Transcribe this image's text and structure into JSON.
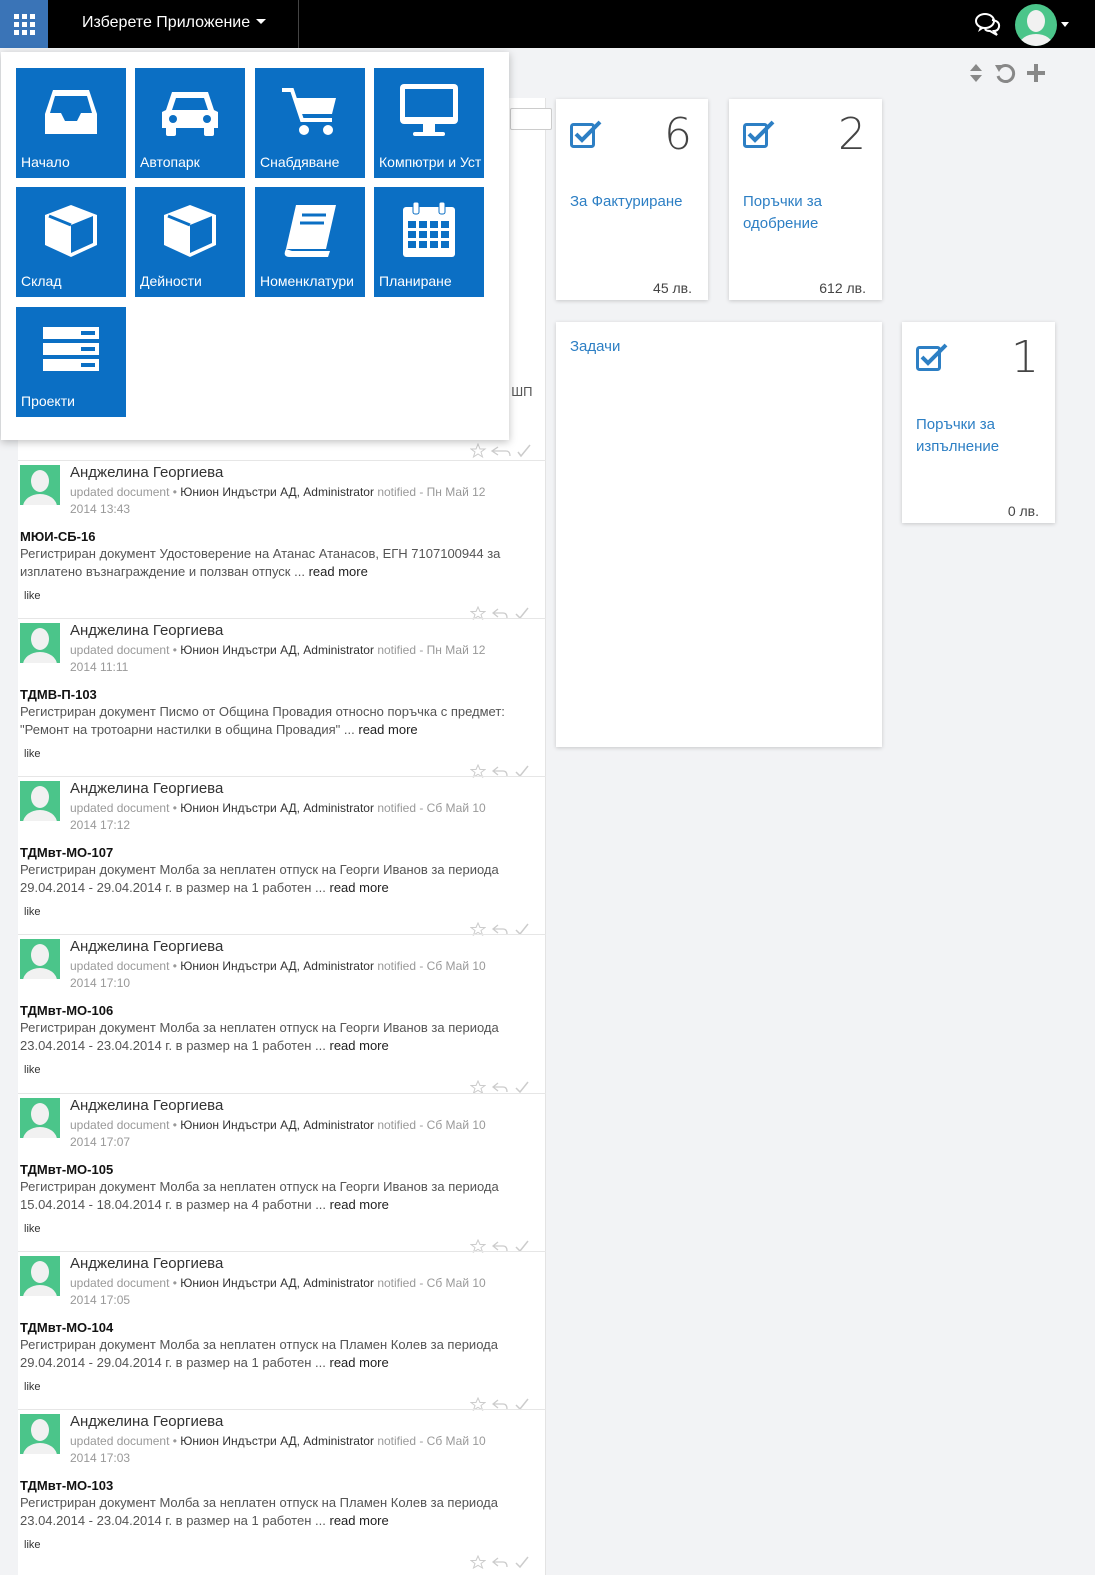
{
  "header": {
    "app_select_label": "Изберете Приложение"
  },
  "launcher": {
    "tiles": [
      {
        "label": "Начало",
        "icon": "inbox-icon"
      },
      {
        "label": "Автопарк",
        "icon": "car-icon"
      },
      {
        "label": "Снабдяване",
        "icon": "cart-icon"
      },
      {
        "label": "Компютри и Уст",
        "icon": "monitor-icon"
      },
      {
        "label": "Склад",
        "icon": "box-icon"
      },
      {
        "label": "Дейности",
        "icon": "box-icon"
      },
      {
        "label": "Номенклатури",
        "icon": "book-icon"
      },
      {
        "label": "Планиране",
        "icon": "calendar-icon"
      },
      {
        "label": "Проекти",
        "icon": "server-icon"
      }
    ]
  },
  "feed": {
    "partial_text": "ı ШП",
    "posts": [
      {
        "author": "Анджелина Георгиева",
        "action": "updated document",
        "org": "Юнион Индъстри АД, Administrator",
        "notified": "notified - Пн Май 12",
        "time": "2014 13:43",
        "code": "МЮИ-СБ-16",
        "body": "Регистриран документ Удостоверение на Атанас Атанасов, ЕГН 7107100944 за изплатено възнаграждение и ползван отпуск ...",
        "read_more": "read more",
        "like": "like"
      },
      {
        "author": "Анджелина Георгиева",
        "action": "updated document",
        "org": "Юнион Индъстри АД, Administrator",
        "notified": "notified - Пн Май 12",
        "time": "2014 11:11",
        "code": "ТДМВ-П-103",
        "body": "Регистриран документ Писмо от Община Провадия относно поръчка с предмет: \"Ремонт на тротоарни настилки в община Провадия\" ...",
        "read_more": "read more",
        "like": "like"
      },
      {
        "author": "Анджелина Георгиева",
        "action": "updated document",
        "org": "Юнион Индъстри АД, Administrator",
        "notified": "notified - Сб Май 10",
        "time": "2014 17:12",
        "code": "ТДМвт-МО-107",
        "body": "Регистриран документ Молба за неплатен отпуск на Георги Иванов за периода 29.04.2014 - 29.04.2014 г. в размер на 1 работен ...",
        "read_more": "read more",
        "like": "like"
      },
      {
        "author": "Анджелина Георгиева",
        "action": "updated document",
        "org": "Юнион Индъстри АД, Administrator",
        "notified": "notified - Сб Май 10",
        "time": "2014 17:10",
        "code": "ТДМвт-МО-106",
        "body": "Регистриран документ Молба за неплатен отпуск на Георги Иванов за периода 23.04.2014 - 23.04.2014 г. в размер на 1 работен ...",
        "read_more": "read more",
        "like": "like"
      },
      {
        "author": "Анджелина Георгиева",
        "action": "updated document",
        "org": "Юнион Индъстри АД, Administrator",
        "notified": "notified - Сб Май 10",
        "time": "2014 17:07",
        "code": "ТДМвт-МО-105",
        "body": "Регистриран документ Молба за неплатен отпуск на Георги Иванов за периода 15.04.2014 - 18.04.2014 г. в размер на 4 работни ...",
        "read_more": "read more",
        "like": "like"
      },
      {
        "author": "Анджелина Георгиева",
        "action": "updated document",
        "org": "Юнион Индъстри АД, Administrator",
        "notified": "notified - Сб Май 10",
        "time": "2014 17:05",
        "code": "ТДМвт-МО-104",
        "body": "Регистриран документ Молба за неплатен отпуск на Пламен Колев за периода 29.04.2014 - 29.04.2014 г. в размер на 1 работен ...",
        "read_more": "read more",
        "like": "like"
      },
      {
        "author": "Анджелина Георгиева",
        "action": "updated document",
        "org": "Юнион Индъстри АД, Administrator",
        "notified": "notified - Сб Май 10",
        "time": "2014 17:03",
        "code": "ТДМвт-МО-103",
        "body": "Регистриран документ Молба за неплатен отпуск на Пламен Колев за периода 23.04.2014 - 23.04.2014 г. в размер на 1 работен ...",
        "read_more": "read more",
        "like": "like"
      }
    ]
  },
  "cards": {
    "invoicing": {
      "count": "6",
      "title": "За Фактуриране",
      "amount": "45 лв."
    },
    "orders_approval": {
      "count": "2",
      "title": "Поръчки за одобрение",
      "amount": "612 лв."
    },
    "tasks": {
      "title": "Задачи"
    },
    "orders_execution": {
      "count": "1",
      "title": "Поръчки за изпълнение",
      "amount": "0 лв."
    }
  },
  "colors": {
    "topbar": "#000000",
    "apps_button": "#3a74b7",
    "tile": "#0b6fc4",
    "accent_link": "#2d7fc4",
    "avatar": "#4bc58a"
  }
}
